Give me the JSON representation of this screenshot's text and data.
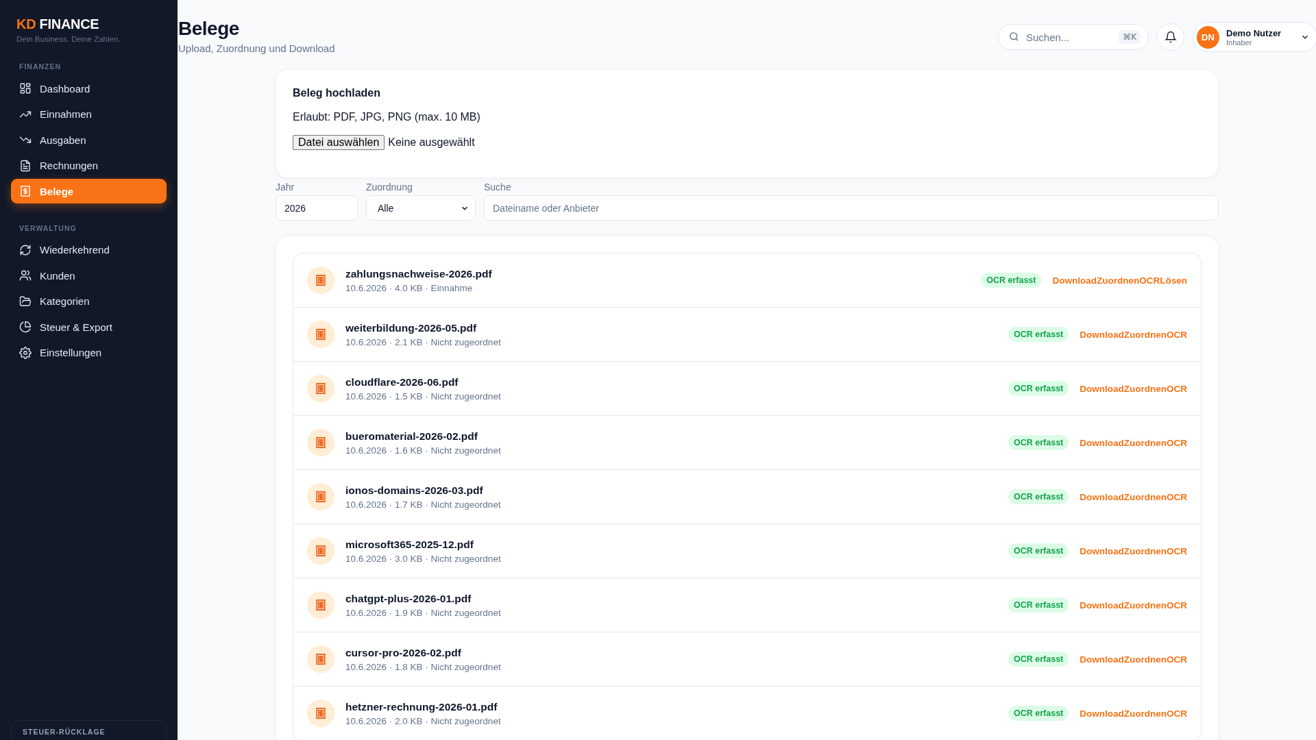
{
  "brand": {
    "accent": "KD",
    "name": "FINANCE",
    "tagline": "Dein Business. Deine Zahlen."
  },
  "nav": [
    {
      "title": "FINANZEN",
      "items": [
        {
          "label": "Dashboard",
          "kind": "grid",
          "selected": false
        },
        {
          "label": "Einnahmen",
          "kind": "trend_up",
          "selected": false
        },
        {
          "label": "Ausgaben",
          "kind": "trend_down",
          "selected": false
        },
        {
          "label": "Rechnungen",
          "kind": "document",
          "selected": false
        },
        {
          "label": "Belege",
          "kind": "receipt",
          "selected": true
        }
      ]
    },
    {
      "title": "VERWALTUNG",
      "items": [
        {
          "label": "Wiederkehrend",
          "kind": "refresh",
          "selected": false
        },
        {
          "label": "Kunden",
          "kind": "users",
          "selected": false
        },
        {
          "label": "Kategorien",
          "kind": "folder",
          "selected": false
        },
        {
          "label": "Steuer & Export",
          "kind": "pie",
          "selected": false
        },
        {
          "label": "Einstellungen",
          "kind": "gear",
          "selected": false
        }
      ]
    }
  ],
  "sidebar_card": {
    "title": "STEUER-RÜCKLAGE"
  },
  "header": {
    "title": "Belege",
    "subtitle": "Upload, Zuordnung und Download",
    "search": {
      "placeholder": "Suchen...",
      "shortcut": "⌘K"
    },
    "user": {
      "initials": "DN",
      "name": "Demo Nutzer",
      "role": "Inhaber"
    }
  },
  "upload": {
    "title": "Beleg hochladen",
    "hint": "Erlaubt: PDF, JPG, PNG (max. 10 MB)",
    "button": "Datei auswählen",
    "status": "Keine ausgewählt"
  },
  "filters": {
    "year": {
      "label": "Jahr",
      "value": "2026"
    },
    "assignment": {
      "label": "Zuordnung",
      "value": "Alle"
    },
    "search": {
      "label": "Suche",
      "placeholder": "Dateiname oder Anbieter"
    }
  },
  "files": [
    {
      "name": "zahlungsnachweise-2026.pdf",
      "meta": "10.6.2026 · 4.0 KB · Einnahme",
      "status": "OCR erfasst",
      "actions": [
        "Download",
        "Zuordnen",
        "OCR",
        "Lösen"
      ]
    },
    {
      "name": "weiterbildung-2026-05.pdf",
      "meta": "10.6.2026 · 2.1 KB · Nicht zugeordnet",
      "status": "OCR erfasst",
      "actions": [
        "Download",
        "Zuordnen",
        "OCR"
      ]
    },
    {
      "name": "cloudflare-2026-06.pdf",
      "meta": "10.6.2026 · 1.5 KB · Nicht zugeordnet",
      "status": "OCR erfasst",
      "actions": [
        "Download",
        "Zuordnen",
        "OCR"
      ]
    },
    {
      "name": "bueromaterial-2026-02.pdf",
      "meta": "10.6.2026 · 1.6 KB · Nicht zugeordnet",
      "status": "OCR erfasst",
      "actions": [
        "Download",
        "Zuordnen",
        "OCR"
      ]
    },
    {
      "name": "ionos-domains-2026-03.pdf",
      "meta": "10.6.2026 · 1.7 KB · Nicht zugeordnet",
      "status": "OCR erfasst",
      "actions": [
        "Download",
        "Zuordnen",
        "OCR"
      ]
    },
    {
      "name": "microsoft365-2025-12.pdf",
      "meta": "10.6.2026 · 3.0 KB · Nicht zugeordnet",
      "status": "OCR erfasst",
      "actions": [
        "Download",
        "Zuordnen",
        "OCR"
      ]
    },
    {
      "name": "chatgpt-plus-2026-01.pdf",
      "meta": "10.6.2026 · 1.9 KB · Nicht zugeordnet",
      "status": "OCR erfasst",
      "actions": [
        "Download",
        "Zuordnen",
        "OCR"
      ]
    },
    {
      "name": "cursor-pro-2026-02.pdf",
      "meta": "10.6.2026 · 1.8 KB · Nicht zugeordnet",
      "status": "OCR erfasst",
      "actions": [
        "Download",
        "Zuordnen",
        "OCR"
      ]
    },
    {
      "name": "hetzner-rechnung-2026-01.pdf",
      "meta": "10.6.2026 · 2.0 KB · Nicht zugeordnet",
      "status": "OCR erfasst",
      "actions": [
        "Download",
        "Zuordnen",
        "OCR"
      ]
    }
  ]
}
